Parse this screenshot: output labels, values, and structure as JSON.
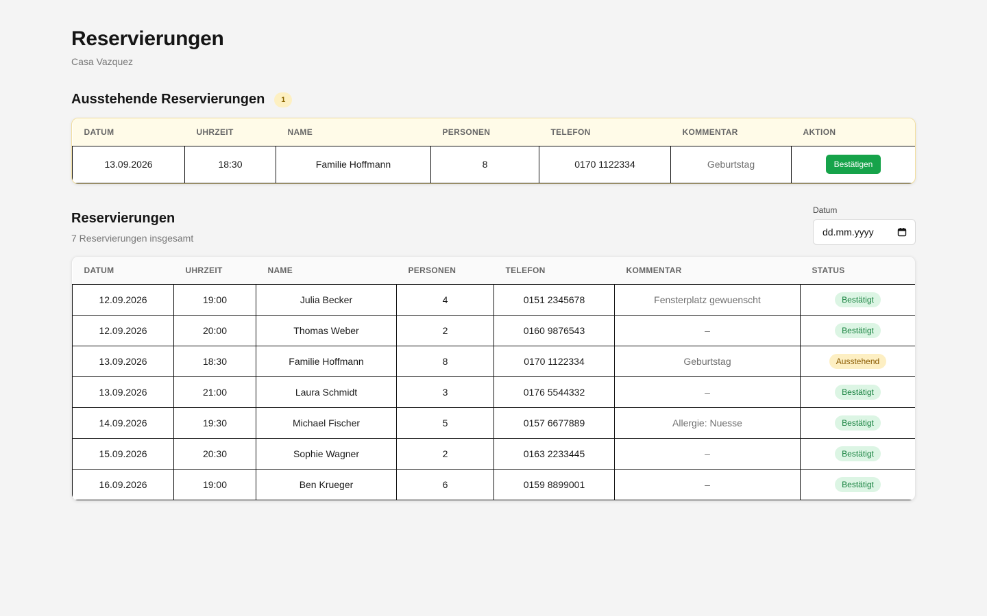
{
  "header": {
    "title": "Reservierungen",
    "subtitle": "Casa Vazquez"
  },
  "pending": {
    "title": "Ausstehende Reservierungen",
    "count": "1",
    "columns": [
      "DATUM",
      "UHRZEIT",
      "NAME",
      "PERSONEN",
      "TELEFON",
      "KOMMENTAR",
      "AKTION"
    ],
    "rows": [
      {
        "date": "13.09.2026",
        "time": "18:30",
        "name": "Familie Hoffmann",
        "persons": "8",
        "phone": "0170 1122334",
        "comment": "Geburtstag",
        "action_label": "Bestätigen"
      }
    ]
  },
  "reservations": {
    "title": "Reservierungen",
    "count_text": "7 Reservierungen insgesamt",
    "date_filter": {
      "label": "Datum",
      "placeholder": "dd.mm.yyyy"
    },
    "columns": [
      "DATUM",
      "UHRZEIT",
      "NAME",
      "PERSONEN",
      "TELEFON",
      "KOMMENTAR",
      "STATUS"
    ],
    "rows": [
      {
        "date": "12.09.2026",
        "time": "19:00",
        "name": "Julia Becker",
        "persons": "4",
        "phone": "0151 2345678",
        "comment": "Fensterplatz gewuenscht",
        "status": "Bestätigt",
        "status_type": "confirmed"
      },
      {
        "date": "12.09.2026",
        "time": "20:00",
        "name": "Thomas Weber",
        "persons": "2",
        "phone": "0160 9876543",
        "comment": "–",
        "status": "Bestätigt",
        "status_type": "confirmed"
      },
      {
        "date": "13.09.2026",
        "time": "18:30",
        "name": "Familie Hoffmann",
        "persons": "8",
        "phone": "0170 1122334",
        "comment": "Geburtstag",
        "status": "Ausstehend",
        "status_type": "pending"
      },
      {
        "date": "13.09.2026",
        "time": "21:00",
        "name": "Laura Schmidt",
        "persons": "3",
        "phone": "0176 5544332",
        "comment": "–",
        "status": "Bestätigt",
        "status_type": "confirmed"
      },
      {
        "date": "14.09.2026",
        "time": "19:30",
        "name": "Michael Fischer",
        "persons": "5",
        "phone": "0157 6677889",
        "comment": "Allergie: Nuesse",
        "status": "Bestätigt",
        "status_type": "confirmed"
      },
      {
        "date": "15.09.2026",
        "time": "20:30",
        "name": "Sophie Wagner",
        "persons": "2",
        "phone": "0163 2233445",
        "comment": "–",
        "status": "Bestätigt",
        "status_type": "confirmed"
      },
      {
        "date": "16.09.2026",
        "time": "19:00",
        "name": "Ben Krueger",
        "persons": "6",
        "phone": "0159 8899001",
        "comment": "–",
        "status": "Bestätigt",
        "status_type": "confirmed"
      }
    ]
  },
  "icons": {
    "date_picker": "calendar-icon"
  },
  "colors": {
    "confirm_button": "#16a34a",
    "confirmed_badge_bg": "#dcf5e4",
    "confirmed_badge_text": "#15803d",
    "pending_badge_bg": "#fdefc3",
    "pending_badge_text": "#8a5a00",
    "pending_header_bg": "#fffbe8"
  }
}
